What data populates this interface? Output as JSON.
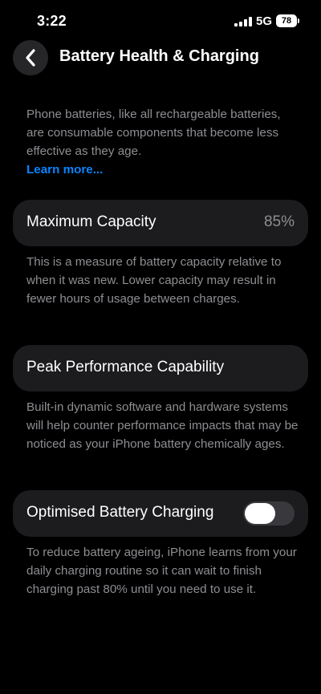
{
  "status_bar": {
    "time": "3:22",
    "network": "5G",
    "battery": "78",
    "icons": [
      "signal-icon",
      "battery-icon"
    ]
  },
  "nav": {
    "title": "Battery Health & Charging",
    "back_icon": "chevron-left-icon"
  },
  "intro": {
    "text": "Phone batteries, like all rechargeable batteries, are consumable components that become less effective as they age.",
    "link": "Learn more..."
  },
  "max_capacity": {
    "label": "Maximum Capacity",
    "value": "85%",
    "description": "This is a measure of battery capacity relative to when it was new. Lower capacity may result in fewer hours of usage between charges."
  },
  "peak_performance": {
    "label": "Peak Performance Capability",
    "description": "Built-in dynamic software and hardware systems will help counter performance impacts that may be noticed as your iPhone battery chemically ages."
  },
  "optimised_charging": {
    "label": "Optimised Battery Charging",
    "enabled": false,
    "description": "To reduce battery ageing, iPhone learns from your daily charging routine so it can wait to finish charging past 80% until you need to use it."
  },
  "colors": {
    "background": "#000000",
    "card": "#1c1c1e",
    "secondary_text": "#8e8e93",
    "link": "#0a84ff",
    "toggle_off": "#39393d"
  }
}
